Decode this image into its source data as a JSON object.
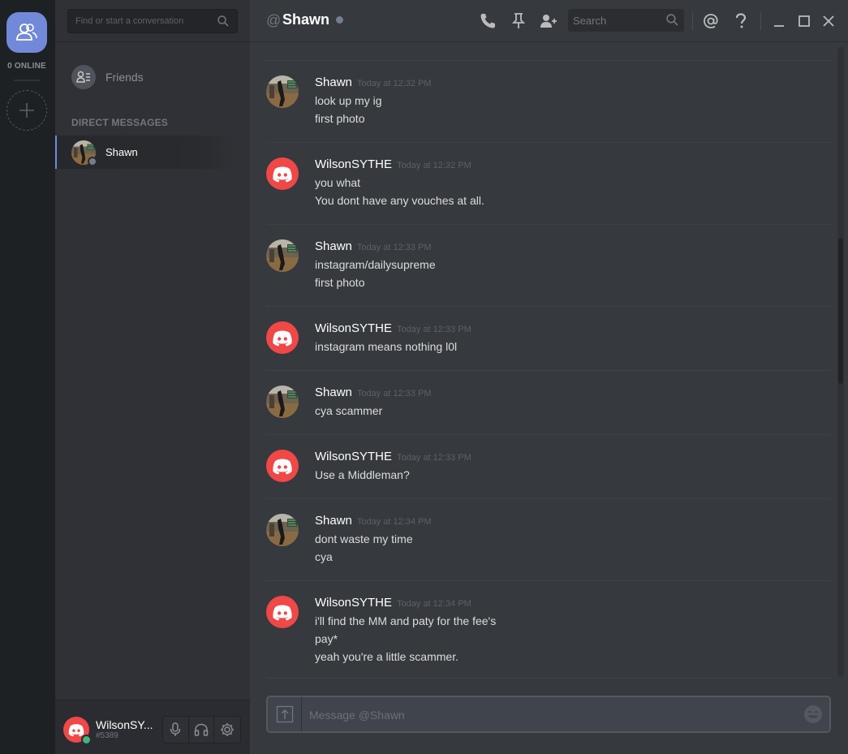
{
  "rail": {
    "online_count": "0 ONLINE"
  },
  "sidebar": {
    "search_placeholder": "Find or start a conversation",
    "friends_label": "Friends",
    "dm_header": "DIRECT MESSAGES",
    "dm_items": [
      {
        "name": "Shawn",
        "status": "offline"
      }
    ]
  },
  "user_panel": {
    "name": "WilsonSY...",
    "tag": "#5389"
  },
  "header": {
    "at": "@",
    "channel_name": "Shawn",
    "search_placeholder": "Search"
  },
  "composer": {
    "placeholder": "Message @Shawn"
  },
  "colors": {
    "accent": "#7289da",
    "discord_red": "#f04747",
    "online": "#43b581",
    "offline": "#747f8d"
  },
  "messages": [
    {
      "author": "Shawn",
      "avatar": "photo",
      "time": "Today at 12:32 PM",
      "lines": [
        "look up my ig",
        "first photo"
      ]
    },
    {
      "author": "WilsonSYTHE",
      "avatar": "discord-logo",
      "time": "Today at 12:32 PM",
      "lines": [
        "you what",
        "You dont have any vouches at all."
      ]
    },
    {
      "author": "Shawn",
      "avatar": "photo",
      "time": "Today at 12:33 PM",
      "lines": [
        "instagram/dailysupreme",
        "first photo"
      ]
    },
    {
      "author": "WilsonSYTHE",
      "avatar": "discord-logo",
      "time": "Today at 12:33 PM",
      "lines": [
        "instagram means nothing l0l"
      ]
    },
    {
      "author": "Shawn",
      "avatar": "photo",
      "time": "Today at 12:33 PM",
      "lines": [
        "cya scammer"
      ]
    },
    {
      "author": "WilsonSYTHE",
      "avatar": "discord-logo",
      "time": "Today at 12:33 PM",
      "lines": [
        "Use a Middleman?"
      ]
    },
    {
      "author": "Shawn",
      "avatar": "photo",
      "time": "Today at 12:34 PM",
      "lines": [
        "dont waste my time",
        "cya"
      ]
    },
    {
      "author": "WilsonSYTHE",
      "avatar": "discord-logo",
      "time": "Today at 12:34 PM",
      "lines": [
        "i'll find the MM and paty for the fee's",
        "pay*",
        "yeah you're a little scammer."
      ]
    }
  ]
}
